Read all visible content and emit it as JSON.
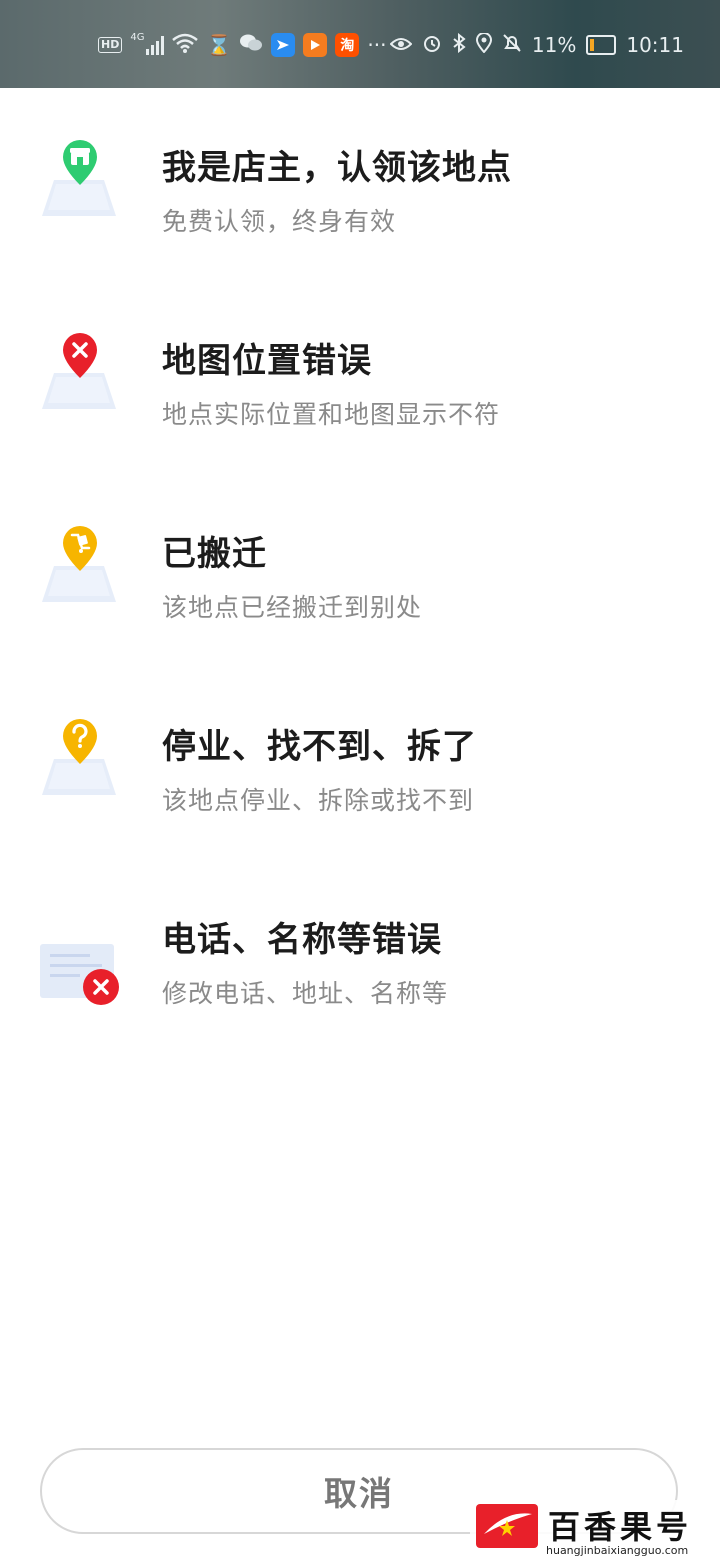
{
  "status_bar": {
    "network": "4G",
    "battery": "11%",
    "time": "10:11",
    "apps": [
      "feishu-icon",
      "video-icon",
      "taobao-icon"
    ],
    "taobao_label": "淘"
  },
  "options": [
    {
      "title": "我是店主，认领该地点",
      "subtitle": "免费认领，终身有效",
      "icon": "store-pin-icon",
      "color": "#2ecc71"
    },
    {
      "title": "地图位置错误",
      "subtitle": "地点实际位置和地图显示不符",
      "icon": "error-pin-icon",
      "color": "#e8202a"
    },
    {
      "title": "已搬迁",
      "subtitle": "该地点已经搬迁到别处",
      "icon": "moved-pin-icon",
      "color": "#f7b500"
    },
    {
      "title": "停业、找不到、拆了",
      "subtitle": "该地点停业、拆除或找不到",
      "icon": "question-pin-icon",
      "color": "#f7b500"
    },
    {
      "title": "电话、名称等错误",
      "subtitle": "修改电话、地址、名称等",
      "icon": "info-error-icon",
      "color": "#e8202a"
    }
  ],
  "cancel_label": "取消",
  "watermark": {
    "text": "百香果号",
    "url": "huangjinbaixiangguo.com"
  }
}
